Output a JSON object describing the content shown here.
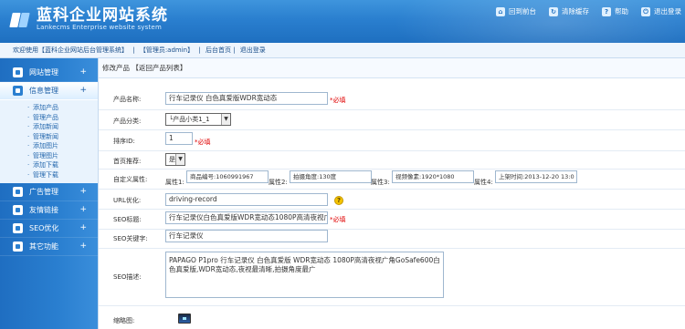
{
  "header": {
    "title": "蓝科企业网站系统",
    "subtitle": "Lankecms Enterprise website system",
    "actions": [
      {
        "label": "回到前台",
        "icon": "home-icon"
      },
      {
        "label": "清除缓存",
        "icon": "refresh-icon"
      },
      {
        "label": "帮助",
        "icon": "help-icon"
      },
      {
        "label": "退出登录",
        "icon": "logout-icon"
      }
    ]
  },
  "subbar": {
    "welcome": "欢迎使用【蓝科企业网站后台管理系统】",
    "admin": "【管理员:admin】",
    "home_link": "后台首页",
    "logout_link": "退出登录",
    "sep": "|"
  },
  "sidebar": {
    "groups": [
      {
        "label": "网站管理",
        "icon": "globe-icon",
        "toggle": "+"
      },
      {
        "label": "信息管理",
        "icon": "info-icon",
        "toggle": "+"
      },
      {
        "label": "广告管理",
        "icon": "ad-icon",
        "toggle": "+"
      },
      {
        "label": "友情链接",
        "icon": "link-icon",
        "toggle": "+"
      },
      {
        "label": "SEO优化",
        "icon": "seo-icon",
        "toggle": "+"
      },
      {
        "label": "其它功能",
        "icon": "puzzle-icon",
        "toggle": "+"
      }
    ],
    "sub_items": [
      "添加产品",
      "管理产品",
      "添加新闻",
      "管理新闻",
      "添加图片",
      "管理图片",
      "添加下载",
      "管理下载"
    ]
  },
  "breadcrumb": {
    "text": "修改产品",
    "back_link": "【返回产品列表】"
  },
  "form": {
    "product_name_label": "产品名称:",
    "product_name_value": "行车记录仪 白色真爱版WDR宽动态",
    "required": "*必填",
    "category_label": "产品分类:",
    "category_value": "└产品小类1_1",
    "sort_label": "排序ID:",
    "sort_value": "1",
    "home_rec_label": "首页推荐:",
    "home_rec_value": "是",
    "attr_label": "自定义属性:",
    "attrs": [
      {
        "label": "属性1:",
        "value": "商品编号:1060991967"
      },
      {
        "label": "属性2:",
        "value": "拍摄角度:130度"
      },
      {
        "label": "属性3:",
        "value": "视频像素:1920*1080"
      },
      {
        "label": "属性4:",
        "value": "上架时间:2013-12-20 13:0"
      }
    ],
    "url_label": "URL优化:",
    "url_value": "driving-record",
    "url_help": "?",
    "seo_title_label": "SEO标题:",
    "seo_title_value": "行车记录仪白色真爱版WDR宽动态1080P高清夜视广",
    "seo_keywords_label": "SEO关键字:",
    "seo_keywords_value": "行车记录仪",
    "seo_desc_label": "SEO描述:",
    "seo_desc_value": "PAPAGO P1pro 行车记录仪 白色真爱版 WDR宽动态 1080P高清夜视广角GoSafe600白色真爱版,WDR宽动态,夜视最清晰,拍摄角度最广",
    "thumb_label": "缩略图:"
  },
  "colors": {
    "header": "#2a7fcf",
    "sidebar": "#2a7fd0",
    "required": "#e00000"
  }
}
